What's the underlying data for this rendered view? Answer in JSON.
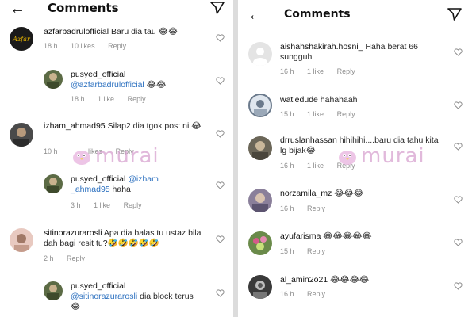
{
  "left_panel": {
    "header": {
      "title": "Comments"
    },
    "watermark": "murai",
    "comments": [
      {
        "user": "azfarbadrulofficial",
        "text": "Baru dia tau 😂😂",
        "time": "18 h",
        "likes": "10 likes",
        "reply": "Reply",
        "avatar_color": "#1a1a1a",
        "avatar_accent": "#e6b400"
      },
      {
        "user": "pusyed_official",
        "mention": "@azfarbadrulofficial",
        "text": " 😂😂",
        "time": "18 h",
        "likes": "1 like",
        "reply": "Reply",
        "avatar_color": "#5c6b45",
        "avatar_accent": "#c9b28e"
      },
      {
        "user": "izham_ahmad95",
        "text": "Silap2 dia tgok post ni 😂",
        "time": "10 h",
        "likes": "likes",
        "reply": "Reply",
        "avatar_color": "#4a4a4a",
        "avatar_accent": "#b89a7c"
      },
      {
        "user": "pusyed_official",
        "mention": "@izham _ahmad95",
        "text": " haha",
        "time": "3 h",
        "likes": "1 like",
        "reply": "Reply",
        "avatar_color": "#5c6b45",
        "avatar_accent": "#c9b28e"
      },
      {
        "user": "sitinorazurarosli",
        "text": "Apa dia balas tu ustaz bila dah bagi resit tu?🤣🤣🤣🤣🤣",
        "time": "2 h",
        "likes": "",
        "reply": "Reply",
        "avatar_color": "#e8c9c0",
        "avatar_accent": "#a07866"
      },
      {
        "user": "pusyed_official",
        "mention": "@sitinorazurarosli",
        "text": " dia block terus😂",
        "time": "",
        "likes": "",
        "reply": "",
        "avatar_color": "#5c6b45",
        "avatar_accent": "#c9b28e"
      }
    ]
  },
  "right_panel": {
    "header": {
      "title": "Comments"
    },
    "watermark": "murai",
    "comments": [
      {
        "user": "aishahshakirah.hosni_",
        "text": "Haha berat 66 sungguh",
        "time": "16 h",
        "likes": "1 like",
        "reply": "Reply",
        "avatar_color": "#e4e4e4",
        "avatar_accent": "#ffffff"
      },
      {
        "user": "watiedude",
        "text": "hahahaah",
        "time": "15 h",
        "likes": "1 like",
        "reply": "Reply",
        "avatar_color": "#dfe6ee",
        "avatar_accent": "#6b7a8c"
      },
      {
        "user": "drruslanhassan",
        "text": "hihihihi....baru dia tahu kita lg bijak😂",
        "time": "16 h",
        "likes": "1 like",
        "reply": "Reply",
        "avatar_color": "#6b6658",
        "avatar_accent": "#c9b79a"
      },
      {
        "user": "norzamila_mz",
        "text": "😂😂😂",
        "time": "16 h",
        "likes": "",
        "reply": "Reply",
        "avatar_color": "#8a7f9a",
        "avatar_accent": "#d8c2b0"
      },
      {
        "user": "ayufarisma",
        "text": "😂😂😂😂😂",
        "time": "15 h",
        "likes": "",
        "reply": "Reply",
        "avatar_color": "#6a8a4a",
        "avatar_accent": "#d65a8a"
      },
      {
        "user": "al_amin2o21",
        "text": "😂😂😂😂",
        "time": "16 h",
        "likes": "",
        "reply": "Reply",
        "avatar_color": "#3a3a3a",
        "avatar_accent": "#bdbdbd"
      }
    ]
  },
  "colors": {
    "mention": "#2a6fbf",
    "meta": "#8e8e8e",
    "text": "#262626"
  },
  "icons": {
    "back": "arrow-left-icon",
    "send": "paper-plane-icon",
    "like": "heart-icon"
  }
}
